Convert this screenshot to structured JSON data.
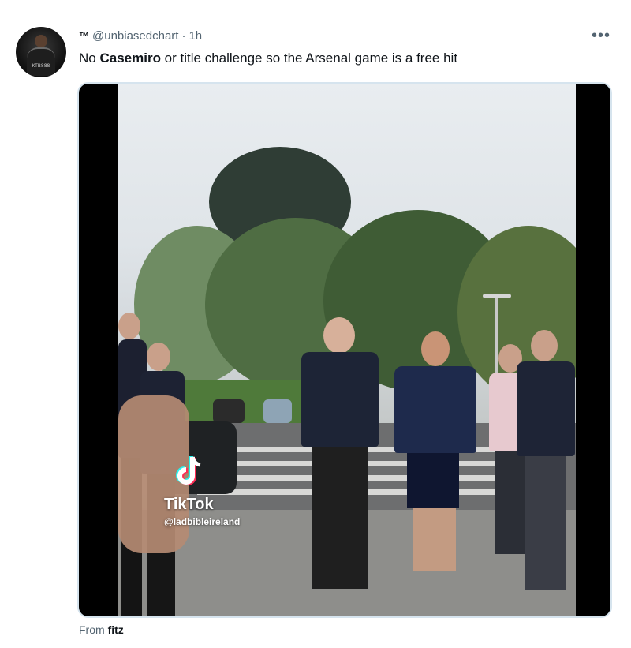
{
  "tweet": {
    "tm_label": "™",
    "handle": "@unbiasedchart",
    "separator": "·",
    "time": "1h",
    "text_before": "No ",
    "text_bold": "Casemiro",
    "text_after": " or title challenge so the Arsenal game is a free hit",
    "more_icon": "more-dots-icon",
    "avatar_text": "KTB888"
  },
  "media": {
    "watermark_brand": "TikTok",
    "watermark_handle": "@ladbibleireland"
  },
  "footer": {
    "from_prefix": "From",
    "from_name": "fitz"
  },
  "colors": {
    "secondary_text": "#536471",
    "primary_text": "#0f1419",
    "media_border": "#d6e4ee"
  }
}
